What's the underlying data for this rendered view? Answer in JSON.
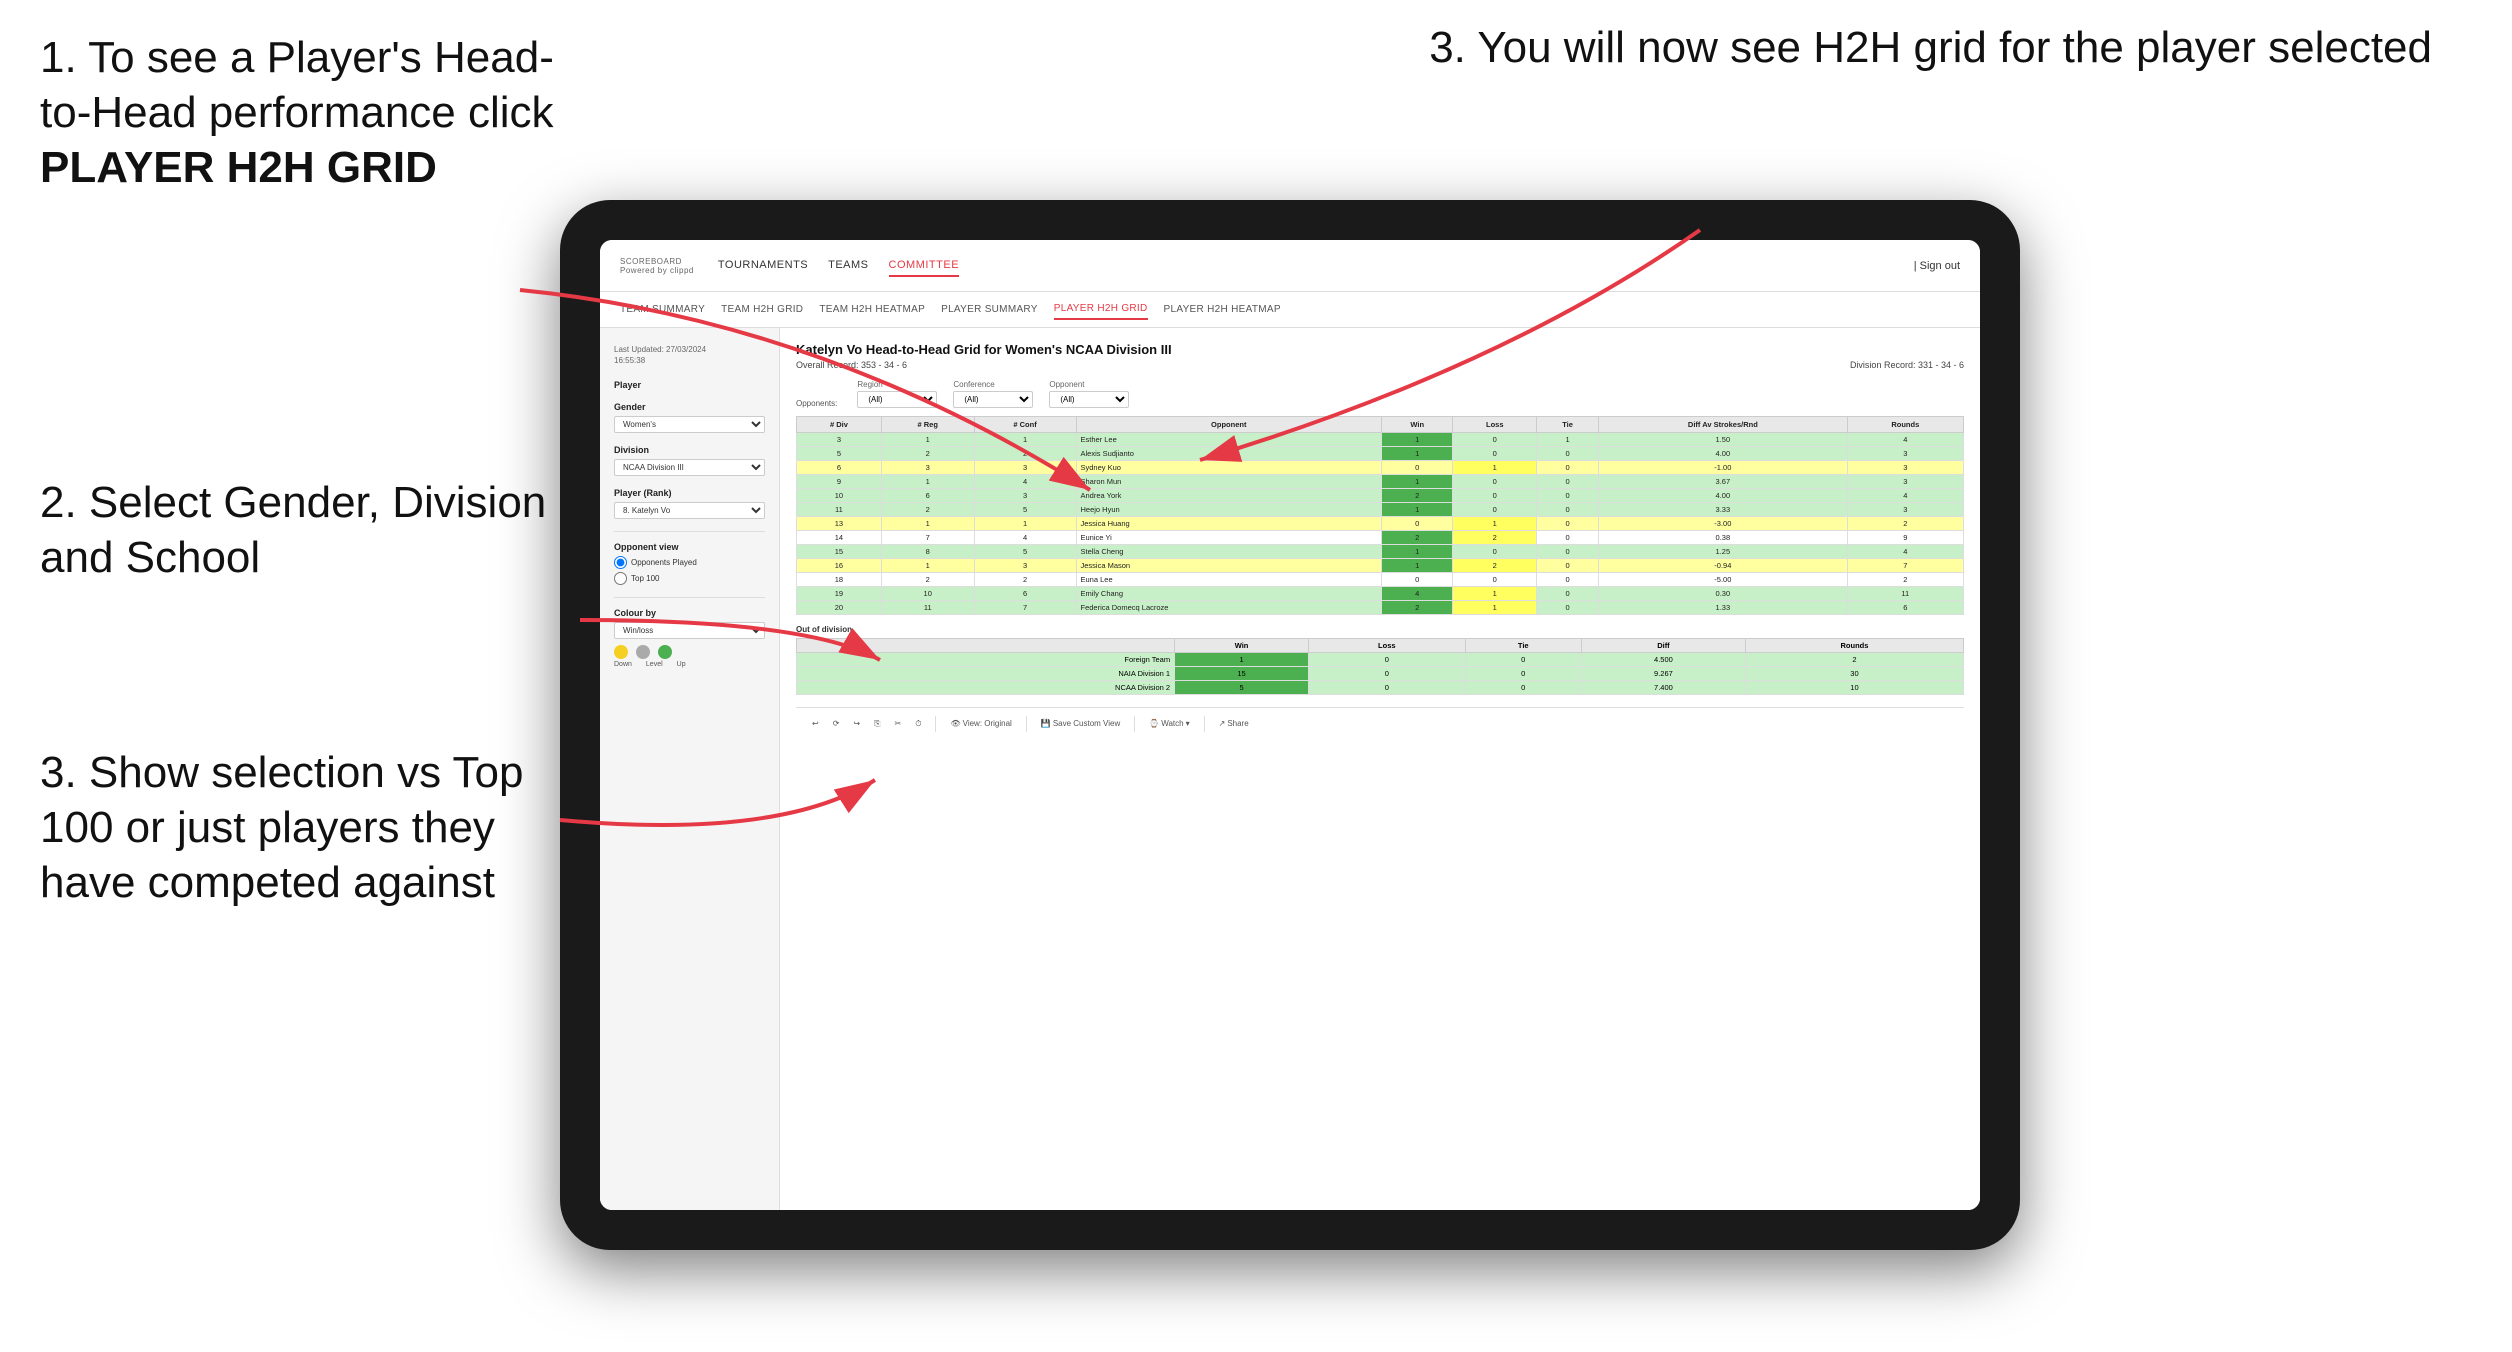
{
  "instructions": {
    "step1": {
      "text": "1. To see a Player's Head-to-Head performance click",
      "bold": "PLAYER H2H GRID"
    },
    "step2": {
      "text": "2. Select Gender, Division and School"
    },
    "step3_left": {
      "text": "3. Show selection vs Top 100 or just players they have competed against"
    },
    "step3_right": {
      "text": "3. You will now see H2H grid for the player selected"
    }
  },
  "app": {
    "logo": "SCOREBOARD",
    "logo_sub": "Powered by clippd",
    "nav_items": [
      "TOURNAMENTS",
      "TEAMS",
      "COMMITTEE"
    ],
    "nav_right": "| Sign out",
    "sub_nav": [
      "TEAM SUMMARY",
      "TEAM H2H GRID",
      "TEAM H2H HEATMAP",
      "PLAYER SUMMARY",
      "PLAYER H2H GRID",
      "PLAYER H2H HEATMAP"
    ]
  },
  "sidebar": {
    "timestamp": "Last Updated: 27/03/2024\n16:55:38",
    "player_label": "Player",
    "gender_label": "Gender",
    "gender_value": "Women's",
    "division_label": "Division",
    "division_value": "NCAA Division III",
    "player_rank_label": "Player (Rank)",
    "player_rank_value": "8. Katelyn Vo",
    "opponent_view_label": "Opponent view",
    "radio1": "Opponents Played",
    "radio2": "Top 100",
    "colour_label": "Colour by",
    "colour_value": "Win/loss",
    "legend": [
      "Down",
      "Level",
      "Up"
    ]
  },
  "main": {
    "title": "Katelyn Vo Head-to-Head Grid for Women's NCAA Division III",
    "overall_record": "Overall Record: 353 - 34 - 6",
    "division_record": "Division Record: 331 - 34 - 6",
    "filter_opponents_label": "Opponents:",
    "filter_region_label": "Region",
    "filter_conference_label": "Conference",
    "filter_opponent_label": "Opponent",
    "filter_region_value": "(All)",
    "filter_conference_value": "(All)",
    "filter_opponent_value": "(All)",
    "table_headers": [
      "# Div",
      "# Reg",
      "# Conf",
      "Opponent",
      "Win",
      "Loss",
      "Tie",
      "Diff Av Strokes/Rnd",
      "Rounds"
    ],
    "table_rows": [
      {
        "div": "3",
        "reg": "1",
        "conf": "1",
        "opponent": "Esther Lee",
        "win": 1,
        "loss": 0,
        "tie": 1,
        "diff": "1.50",
        "rounds": 4,
        "color": "green"
      },
      {
        "div": "5",
        "reg": "2",
        "conf": "2",
        "opponent": "Alexis Sudjianto",
        "win": 1,
        "loss": 0,
        "tie": 0,
        "diff": "4.00",
        "rounds": 3,
        "color": "green"
      },
      {
        "div": "6",
        "reg": "3",
        "conf": "3",
        "opponent": "Sydney Kuo",
        "win": 0,
        "loss": 1,
        "tie": 0,
        "diff": "-1.00",
        "rounds": 3,
        "color": "yellow"
      },
      {
        "div": "9",
        "reg": "1",
        "conf": "4",
        "opponent": "Sharon Mun",
        "win": 1,
        "loss": 0,
        "tie": 0,
        "diff": "3.67",
        "rounds": 3,
        "color": "green"
      },
      {
        "div": "10",
        "reg": "6",
        "conf": "3",
        "opponent": "Andrea York",
        "win": 2,
        "loss": 0,
        "tie": 0,
        "diff": "4.00",
        "rounds": 4,
        "color": "green"
      },
      {
        "div": "11",
        "reg": "2",
        "conf": "5",
        "opponent": "Heejo Hyun",
        "win": 1,
        "loss": 0,
        "tie": 0,
        "diff": "3.33",
        "rounds": 3,
        "color": "green"
      },
      {
        "div": "13",
        "reg": "1",
        "conf": "1",
        "opponent": "Jessica Huang",
        "win": 0,
        "loss": 1,
        "tie": 0,
        "diff": "-3.00",
        "rounds": 2,
        "color": "yellow"
      },
      {
        "div": "14",
        "reg": "7",
        "conf": "4",
        "opponent": "Eunice Yi",
        "win": 2,
        "loss": 2,
        "tie": 0,
        "diff": "0.38",
        "rounds": 9,
        "color": "white"
      },
      {
        "div": "15",
        "reg": "8",
        "conf": "5",
        "opponent": "Stella Cheng",
        "win": 1,
        "loss": 0,
        "tie": 0,
        "diff": "1.25",
        "rounds": 4,
        "color": "green"
      },
      {
        "div": "16",
        "reg": "1",
        "conf": "3",
        "opponent": "Jessica Mason",
        "win": 1,
        "loss": 2,
        "tie": 0,
        "diff": "-0.94",
        "rounds": 7,
        "color": "yellow"
      },
      {
        "div": "18",
        "reg": "2",
        "conf": "2",
        "opponent": "Euna Lee",
        "win": 0,
        "loss": 0,
        "tie": 0,
        "diff": "-5.00",
        "rounds": 2,
        "color": "white"
      },
      {
        "div": "19",
        "reg": "10",
        "conf": "6",
        "opponent": "Emily Chang",
        "win": 4,
        "loss": 1,
        "tie": 0,
        "diff": "0.30",
        "rounds": 11,
        "color": "green"
      },
      {
        "div": "20",
        "reg": "11",
        "conf": "7",
        "opponent": "Federica Domecq Lacroze",
        "win": 2,
        "loss": 1,
        "tie": 0,
        "diff": "1.33",
        "rounds": 6,
        "color": "green"
      }
    ],
    "out_of_division_label": "Out of division",
    "ood_rows": [
      {
        "name": "Foreign Team",
        "win": 1,
        "loss": 0,
        "tie": 0,
        "diff": "4.500",
        "rounds": 2,
        "color": "green"
      },
      {
        "name": "NAIA Division 1",
        "win": 15,
        "loss": 0,
        "tie": 0,
        "diff": "9.267",
        "rounds": 30,
        "color": "green"
      },
      {
        "name": "NCAA Division 2",
        "win": 5,
        "loss": 0,
        "tie": 0,
        "diff": "7.400",
        "rounds": 10,
        "color": "green"
      }
    ],
    "toolbar": {
      "view_original": "View: Original",
      "save_custom": "Save Custom View",
      "watch": "Watch",
      "share": "Share"
    }
  }
}
